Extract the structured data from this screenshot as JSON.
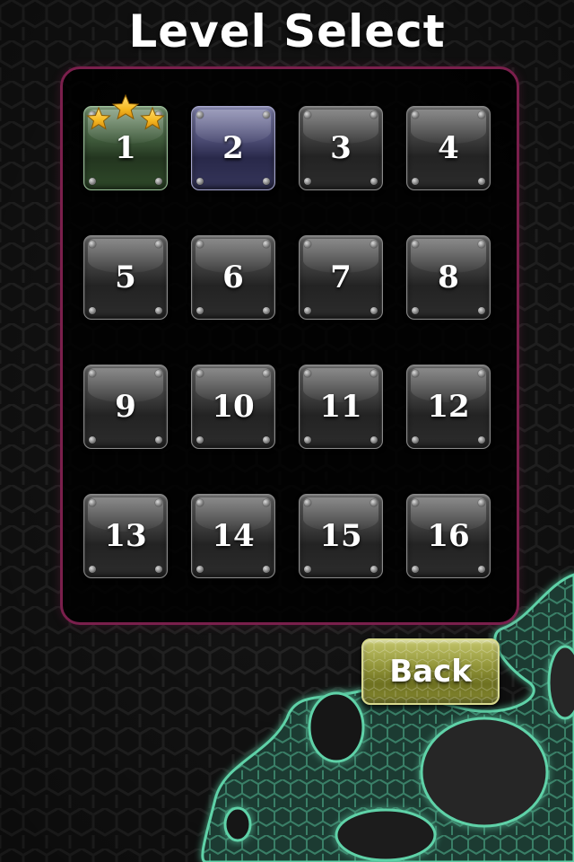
{
  "title": "Level Select",
  "levels": [
    {
      "number": "1",
      "state": "completed",
      "stars": 3
    },
    {
      "number": "2",
      "state": "current",
      "stars": 0
    },
    {
      "number": "3",
      "state": "locked",
      "stars": 0
    },
    {
      "number": "4",
      "state": "locked",
      "stars": 0
    },
    {
      "number": "5",
      "state": "locked",
      "stars": 0
    },
    {
      "number": "6",
      "state": "locked",
      "stars": 0
    },
    {
      "number": "7",
      "state": "locked",
      "stars": 0
    },
    {
      "number": "8",
      "state": "locked",
      "stars": 0
    },
    {
      "number": "9",
      "state": "locked",
      "stars": 0
    },
    {
      "number": "10",
      "state": "locked",
      "stars": 0
    },
    {
      "number": "11",
      "state": "locked",
      "stars": 0
    },
    {
      "number": "12",
      "state": "locked",
      "stars": 0
    },
    {
      "number": "13",
      "state": "locked",
      "stars": 0
    },
    {
      "number": "14",
      "state": "locked",
      "stars": 0
    },
    {
      "number": "15",
      "state": "locked",
      "stars": 0
    },
    {
      "number": "16",
      "state": "locked",
      "stars": 0
    }
  ],
  "back_button": {
    "label": "Back"
  },
  "colors": {
    "panel_border": "#7a1f4c",
    "completed_tile": "#4f6e4a",
    "current_tile": "#4c4c74",
    "locked_tile": "#3a3a3a",
    "back_button": "#8e9136",
    "slime_glow": "#5fd2a8",
    "star": "#f5b820"
  },
  "icons": {
    "star": "star-icon",
    "screw": "screw-icon"
  }
}
